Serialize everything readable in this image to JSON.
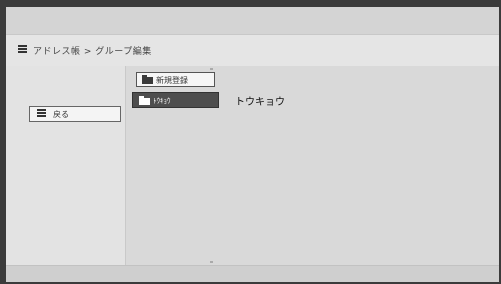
{
  "header": {
    "breadcrumb": "アドレス帳 > グループ編集",
    "icon": "document-list-icon"
  },
  "sidebar": {
    "back_label": "戻る",
    "back_icon": "document-list-icon"
  },
  "main": {
    "new_label": "新規登録",
    "new_icon": "folder-icon",
    "groups": [
      {
        "label": "ﾄｳｷｮｳ",
        "name": "トウキョウ",
        "icon": "folder-icon",
        "selected": true
      }
    ]
  }
}
